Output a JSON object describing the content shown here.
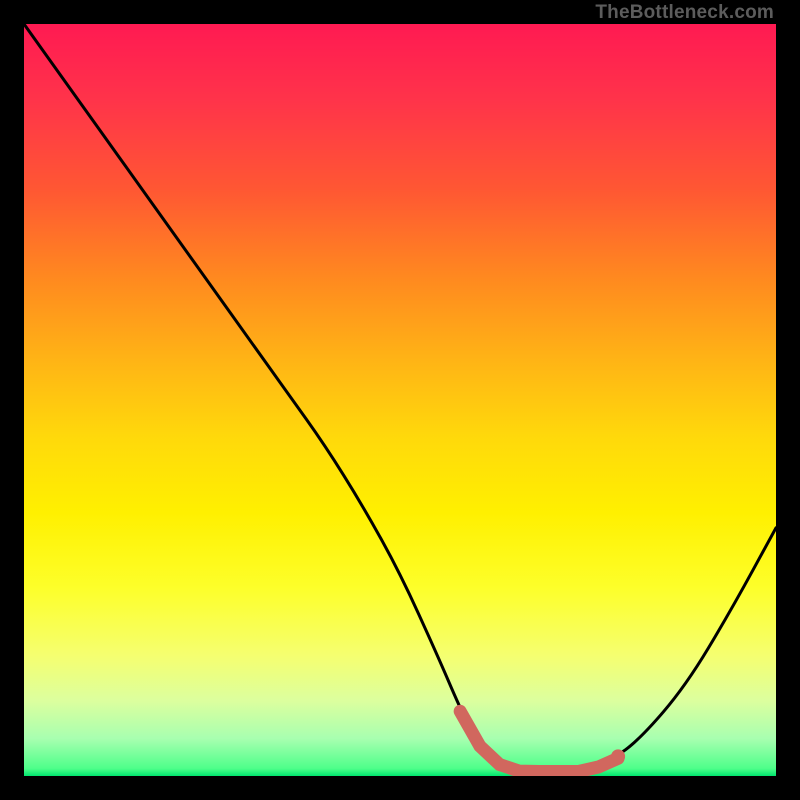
{
  "attribution": "TheBottleneck.com",
  "chart_data": {
    "type": "line",
    "title": "",
    "xlabel": "",
    "ylabel": "",
    "xlim": [
      0,
      100
    ],
    "ylim": [
      0,
      100
    ],
    "series": [
      {
        "name": "bottleneck-curve",
        "x": [
          0,
          5,
          10,
          15,
          20,
          25,
          30,
          35,
          40,
          45,
          50,
          55,
          58,
          60,
          63,
          66,
          70,
          74,
          78,
          82,
          88,
          94,
          100
        ],
        "values": [
          100,
          93,
          86,
          79,
          72,
          65,
          58,
          51,
          44,
          36,
          27,
          16,
          9,
          5,
          2,
          1,
          1,
          1,
          2,
          5,
          12,
          22,
          33
        ]
      }
    ],
    "highlight_band": {
      "name": "optimal-range",
      "x_start": 58,
      "x_end": 79,
      "y": 5,
      "color": "#d1675e"
    },
    "background_gradient": {
      "stops": [
        {
          "pos": 0.0,
          "color": "#ff1a52"
        },
        {
          "pos": 0.22,
          "color": "#ff5733"
        },
        {
          "pos": 0.45,
          "color": "#ffb515"
        },
        {
          "pos": 0.65,
          "color": "#fff000"
        },
        {
          "pos": 0.9,
          "color": "#dcff9e"
        },
        {
          "pos": 1.0,
          "color": "#00e56e"
        }
      ]
    }
  }
}
